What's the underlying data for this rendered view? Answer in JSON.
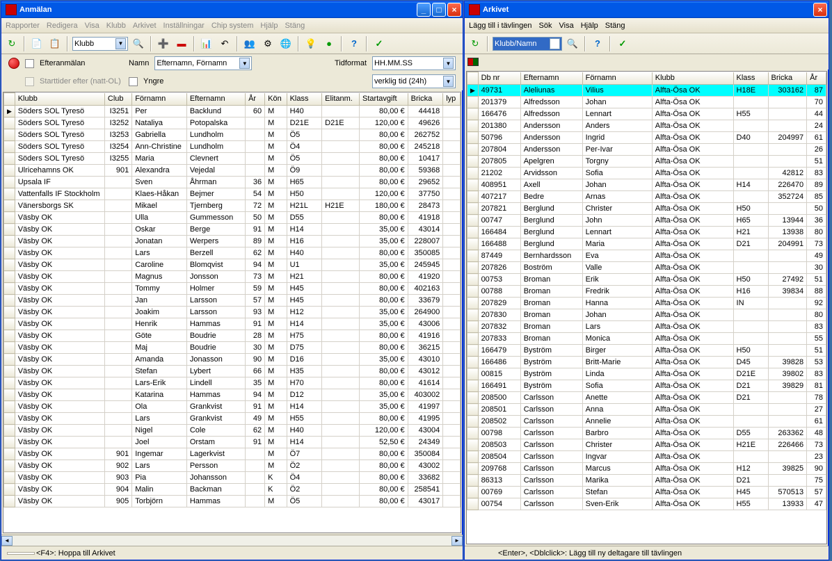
{
  "left": {
    "title": "Anmälan",
    "menu": [
      "Rapporter",
      "Redigera",
      "Visa",
      "Klubb",
      "Arkivet",
      "Inställningar",
      "Chip system",
      "Hjälp",
      "Stäng"
    ],
    "combo_toolbar": "Klubb",
    "form": {
      "chk_efter": "Efteranmälan",
      "chk_start": "Starttider efter (natt-OL)",
      "lbl_namn": "Namn",
      "combo_namn": "Efternamn, Förnamn",
      "chk_yngre": "Yngre",
      "lbl_tid": "Tidformat",
      "combo_tid": "HH.MM.SS",
      "combo_verklig": "verklig tid (24h)"
    },
    "cols": [
      "",
      "Klubb",
      "Club",
      "Förnamn",
      "Efternamn",
      "År",
      "Kön",
      "Klass",
      "Elitanm.",
      "Startavgift",
      "Bricka",
      "lyp"
    ],
    "widths": [
      14,
      115,
      35,
      70,
      75,
      25,
      28,
      45,
      48,
      62,
      45,
      22
    ],
    "rows": [
      [
        "▶",
        "Söders SOL Tyresö",
        "I3251",
        "Per",
        "Backlund",
        "60",
        "M",
        "H40",
        "",
        "80,00 €",
        "44418",
        ""
      ],
      [
        "",
        "Söders SOL Tyresö",
        "I3252",
        "Nataliya",
        "Potopalska",
        "",
        "M",
        "D21E",
        "D21E",
        "120,00 €",
        "49626",
        ""
      ],
      [
        "",
        "Söders SOL Tyresö",
        "I3253",
        "Gabriella",
        "Lundholm",
        "",
        "M",
        "Ö5",
        "",
        "80,00 €",
        "262752",
        ""
      ],
      [
        "",
        "Söders SOL Tyresö",
        "I3254",
        "Ann-Christine",
        "Lundholm",
        "",
        "M",
        "Ö4",
        "",
        "80,00 €",
        "245218",
        ""
      ],
      [
        "",
        "Söders SOL Tyresö",
        "I3255",
        "Maria",
        "Clevnert",
        "",
        "M",
        "Ö5",
        "",
        "80,00 €",
        "10417",
        ""
      ],
      [
        "",
        "Ulricehamns OK",
        "901",
        "Alexandra",
        "Vejedal",
        "",
        "M",
        "Ö9",
        "",
        "80,00 €",
        "59368",
        ""
      ],
      [
        "",
        "Upsala IF",
        "",
        "Sven",
        "Åhrman",
        "36",
        "M",
        "H65",
        "",
        "80,00 €",
        "29652",
        ""
      ],
      [
        "",
        "Vattenfalls IF Stockholm",
        "",
        "Klaes-Håkan",
        "Bejmer",
        "54",
        "M",
        "H50",
        "",
        "120,00 €",
        "37750",
        ""
      ],
      [
        "",
        "Vänersborgs SK",
        "",
        "Mikael",
        "Tjernberg",
        "72",
        "M",
        "H21L",
        "H21E",
        "180,00 €",
        "28473",
        ""
      ],
      [
        "",
        "Väsby OK",
        "",
        "Ulla",
        "Gummesson",
        "50",
        "M",
        "D55",
        "",
        "80,00 €",
        "41918",
        ""
      ],
      [
        "",
        "Väsby OK",
        "",
        "Oskar",
        "Berge",
        "91",
        "M",
        "H14",
        "",
        "35,00 €",
        "43014",
        ""
      ],
      [
        "",
        "Väsby OK",
        "",
        "Jonatan",
        "Werpers",
        "89",
        "M",
        "H16",
        "",
        "35,00 €",
        "228007",
        ""
      ],
      [
        "",
        "Väsby OK",
        "",
        "Lars",
        "Berzell",
        "62",
        "M",
        "H40",
        "",
        "80,00 €",
        "350085",
        ""
      ],
      [
        "",
        "Väsby OK",
        "",
        "Caroline",
        "Blomqvist",
        "94",
        "M",
        "U1",
        "",
        "35,00 €",
        "245945",
        ""
      ],
      [
        "",
        "Väsby OK",
        "",
        "Magnus",
        "Jonsson",
        "73",
        "M",
        "H21",
        "",
        "80,00 €",
        "41920",
        ""
      ],
      [
        "",
        "Väsby OK",
        "",
        "Tommy",
        "Holmer",
        "59",
        "M",
        "H45",
        "",
        "80,00 €",
        "402163",
        ""
      ],
      [
        "",
        "Väsby OK",
        "",
        "Jan",
        "Larsson",
        "57",
        "M",
        "H45",
        "",
        "80,00 €",
        "33679",
        ""
      ],
      [
        "",
        "Väsby OK",
        "",
        "Joakim",
        "Larsson",
        "93",
        "M",
        "H12",
        "",
        "35,00 €",
        "264900",
        ""
      ],
      [
        "",
        "Väsby OK",
        "",
        "Henrik",
        "Hammas",
        "91",
        "M",
        "H14",
        "",
        "35,00 €",
        "43006",
        ""
      ],
      [
        "",
        "Väsby OK",
        "",
        "Göte",
        "Boudrie",
        "28",
        "M",
        "H75",
        "",
        "80,00 €",
        "41916",
        ""
      ],
      [
        "",
        "Väsby OK",
        "",
        "Maj",
        "Boudrie",
        "30",
        "M",
        "D75",
        "",
        "80,00 €",
        "36215",
        ""
      ],
      [
        "",
        "Väsby OK",
        "",
        "Amanda",
        "Jonasson",
        "90",
        "M",
        "D16",
        "",
        "35,00 €",
        "43010",
        ""
      ],
      [
        "",
        "Väsby OK",
        "",
        "Stefan",
        "Lybert",
        "66",
        "M",
        "H35",
        "",
        "80,00 €",
        "43012",
        ""
      ],
      [
        "",
        "Väsby OK",
        "",
        "Lars-Erik",
        "Lindell",
        "35",
        "M",
        "H70",
        "",
        "80,00 €",
        "41614",
        ""
      ],
      [
        "",
        "Väsby OK",
        "",
        "Katarina",
        "Hammas",
        "94",
        "M",
        "D12",
        "",
        "35,00 €",
        "403002",
        ""
      ],
      [
        "",
        "Väsby OK",
        "",
        "Ola",
        "Grankvist",
        "91",
        "M",
        "H14",
        "",
        "35,00 €",
        "41997",
        ""
      ],
      [
        "",
        "Väsby OK",
        "",
        "Lars",
        "Grankvist",
        "49",
        "M",
        "H55",
        "",
        "80,00 €",
        "41995",
        ""
      ],
      [
        "",
        "Väsby OK",
        "",
        "Nigel",
        "Cole",
        "62",
        "M",
        "H40",
        "",
        "120,00 €",
        "43004",
        ""
      ],
      [
        "",
        "Väsby OK",
        "",
        "Joel",
        "Orstam",
        "91",
        "M",
        "H14",
        "",
        "52,50 €",
        "24349",
        ""
      ],
      [
        "",
        "Väsby OK",
        "901",
        "Ingemar",
        "Lagerkvist",
        "",
        "M",
        "Ö7",
        "",
        "80,00 €",
        "350084",
        ""
      ],
      [
        "",
        "Väsby OK",
        "902",
        "Lars",
        "Persson",
        "",
        "M",
        "Ö2",
        "",
        "80,00 €",
        "43002",
        ""
      ],
      [
        "",
        "Väsby OK",
        "903",
        "Pia",
        "Johansson",
        "",
        "K",
        "Ö4",
        "",
        "80,00 €",
        "33682",
        ""
      ],
      [
        "",
        "Väsby OK",
        "904",
        "Malin",
        "Backman",
        "",
        "K",
        "Ö2",
        "",
        "80,00 €",
        "258541",
        ""
      ],
      [
        "",
        "Väsby OK",
        "905",
        "Torbjörn",
        "Hammas",
        "",
        "M",
        "Ö5",
        "",
        "80,00 €",
        "43017",
        ""
      ]
    ],
    "status": "<F4>:  Hoppa till Arkivet"
  },
  "right": {
    "title": "Arkivet",
    "menu": [
      "Lägg till i tävlingen",
      "Sök",
      "Visa",
      "Hjälp",
      "Stäng"
    ],
    "combo_toolbar": "Klubb/Namn",
    "cols": [
      "",
      "Db nr",
      "Efternamn",
      "Förnamn",
      "Klubb",
      "Klass",
      "Bricka",
      "År"
    ],
    "widths": [
      14,
      55,
      80,
      90,
      105,
      45,
      50,
      25
    ],
    "rows": [
      [
        "▶",
        "49731",
        "Aleliunas",
        "Vilius",
        "Alfta-Ösa OK",
        "H18E",
        "303162",
        "87"
      ],
      [
        "",
        "201379",
        "Alfredsson",
        "Johan",
        "Alfta-Ösa OK",
        "",
        "",
        "70"
      ],
      [
        "",
        "166476",
        "Alfredsson",
        "Lennart",
        "Alfta-Ösa OK",
        "H55",
        "",
        "44"
      ],
      [
        "",
        "201380",
        "Andersson",
        "Anders",
        "Alfta-Ösa OK",
        "",
        "",
        "24"
      ],
      [
        "",
        "50796",
        "Andersson",
        "Ingrid",
        "Alfta-Ösa OK",
        "D40",
        "204997",
        "61"
      ],
      [
        "",
        "207804",
        "Andersson",
        "Per-Ivar",
        "Alfta-Ösa OK",
        "",
        "",
        "26"
      ],
      [
        "",
        "207805",
        "Apelgren",
        "Torgny",
        "Alfta-Ösa OK",
        "",
        "",
        "51"
      ],
      [
        "",
        "21202",
        "Arvidsson",
        "Sofia",
        "Alfta-Ösa OK",
        "",
        "42812",
        "83"
      ],
      [
        "",
        "408951",
        "Axell",
        "Johan",
        "Alfta-Ösa OK",
        "H14",
        "226470",
        "89"
      ],
      [
        "",
        "407217",
        "Bedre",
        "Arnas",
        "Alfta-Ösa OK",
        "",
        "352724",
        "85"
      ],
      [
        "",
        "207821",
        "Berglund",
        "Christer",
        "Alfta-Ösa OK",
        "H50",
        "",
        "50"
      ],
      [
        "",
        "00747",
        "Berglund",
        "John",
        "Alfta-Ösa OK",
        "H65",
        "13944",
        "36"
      ],
      [
        "",
        "166484",
        "Berglund",
        "Lennart",
        "Alfta-Ösa OK",
        "H21",
        "13938",
        "80"
      ],
      [
        "",
        "166488",
        "Berglund",
        "Maria",
        "Alfta-Ösa OK",
        "D21",
        "204991",
        "73"
      ],
      [
        "",
        "87449",
        "Bernhardsson",
        "Eva",
        "Alfta-Ösa OK",
        "",
        "",
        "49"
      ],
      [
        "",
        "207826",
        "Boström",
        "Valle",
        "Alfta-Ösa OK",
        "",
        "",
        "30"
      ],
      [
        "",
        "00753",
        "Broman",
        "Erik",
        "Alfta-Ösa OK",
        "H50",
        "27492",
        "51"
      ],
      [
        "",
        "00788",
        "Broman",
        "Fredrik",
        "Alfta-Ösa OK",
        "H16",
        "39834",
        "88"
      ],
      [
        "",
        "207829",
        "Broman",
        "Hanna",
        "Alfta-Ösa OK",
        "IN",
        "",
        "92"
      ],
      [
        "",
        "207830",
        "Broman",
        "Johan",
        "Alfta-Ösa OK",
        "",
        "",
        "80"
      ],
      [
        "",
        "207832",
        "Broman",
        "Lars",
        "Alfta-Ösa OK",
        "",
        "",
        "83"
      ],
      [
        "",
        "207833",
        "Broman",
        "Monica",
        "Alfta-Ösa OK",
        "",
        "",
        "55"
      ],
      [
        "",
        "166479",
        "Byström",
        "Birger",
        "Alfta-Ösa OK",
        "H50",
        "",
        "51"
      ],
      [
        "",
        "166486",
        "Byström",
        "Britt-Marie",
        "Alfta-Ösa OK",
        "D45",
        "39828",
        "53"
      ],
      [
        "",
        "00815",
        "Byström",
        "Linda",
        "Alfta-Ösa OK",
        "D21E",
        "39802",
        "83"
      ],
      [
        "",
        "166491",
        "Byström",
        "Sofia",
        "Alfta-Ösa OK",
        "D21",
        "39829",
        "81"
      ],
      [
        "",
        "208500",
        "Carlsson",
        "Anette",
        "Alfta-Ösa OK",
        "D21",
        "",
        "78"
      ],
      [
        "",
        "208501",
        "Carlsson",
        "Anna",
        "Alfta-Ösa OK",
        "",
        "",
        "27"
      ],
      [
        "",
        "208502",
        "Carlsson",
        "Annelie",
        "Alfta-Ösa OK",
        "",
        "",
        "61"
      ],
      [
        "",
        "00798",
        "Carlsson",
        "Barbro",
        "Alfta-Ösa OK",
        "D55",
        "263362",
        "48"
      ],
      [
        "",
        "208503",
        "Carlsson",
        "Christer",
        "Alfta-Ösa OK",
        "H21E",
        "226466",
        "73"
      ],
      [
        "",
        "208504",
        "Carlsson",
        "Ingvar",
        "Alfta-Ösa OK",
        "",
        "",
        "23"
      ],
      [
        "",
        "209768",
        "Carlsson",
        "Marcus",
        "Alfta-Ösa OK",
        "H12",
        "39825",
        "90"
      ],
      [
        "",
        "86313",
        "Carlsson",
        "Marika",
        "Alfta-Ösa OK",
        "D21",
        "",
        "75"
      ],
      [
        "",
        "00769",
        "Carlsson",
        "Stefan",
        "Alfta-Ösa OK",
        "H45",
        "570513",
        "57"
      ],
      [
        "",
        "00754",
        "Carlsson",
        "Sven-Erik",
        "Alfta-Ösa OK",
        "H55",
        "13933",
        "47"
      ]
    ],
    "status": "<Enter>, <Dblclick>:  Lägg till ny deltagare till tävlingen"
  }
}
